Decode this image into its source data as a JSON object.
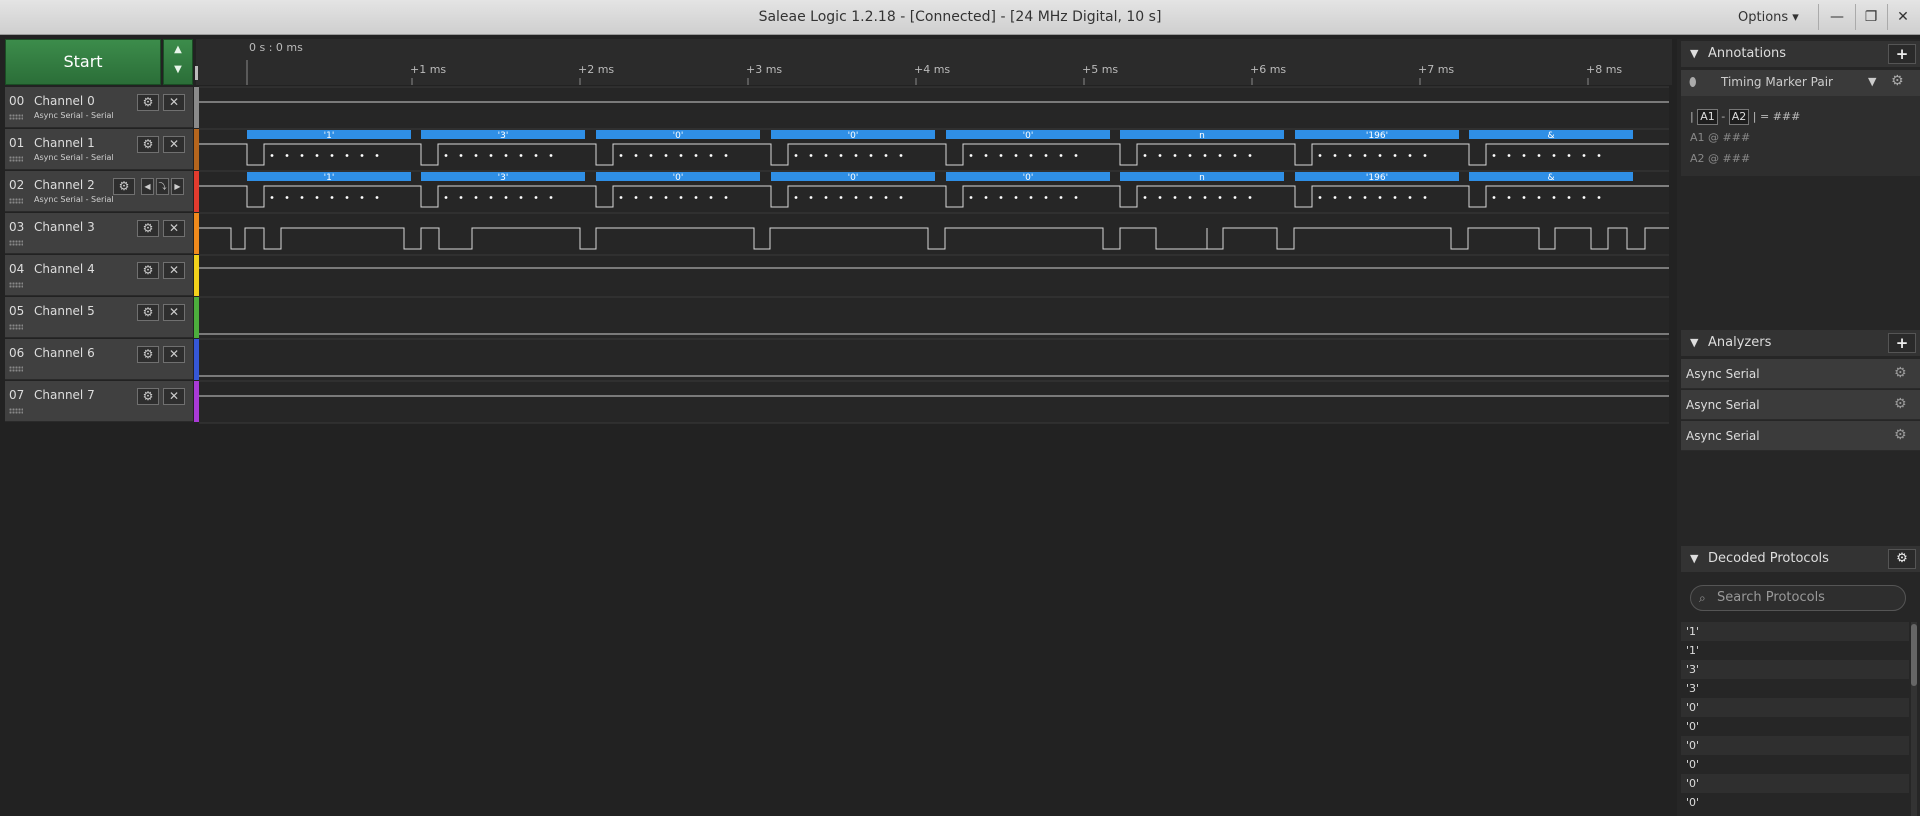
{
  "window": {
    "title": "Saleae Logic 1.2.18 - [Connected] - [24 MHz Digital, 10 s]",
    "options_label": "Options ▾",
    "minimize": "—",
    "restore": "❐",
    "close": "✕"
  },
  "capture": {
    "start_label": "Start",
    "up_arrow": "▲",
    "down_arrow": "▼"
  },
  "timeline": {
    "origin": "0 s : 0 ms",
    "ticks": [
      "+1 ms",
      "+2 ms",
      "+3 ms",
      "+4 ms",
      "+5 ms",
      "+6 ms",
      "+7 ms",
      "+8 ms"
    ]
  },
  "channels": [
    {
      "num": "00",
      "name": "Channel 0",
      "analyzer": "Async Serial - Serial",
      "color": "#8a8a8a"
    },
    {
      "num": "01",
      "name": "Channel 1",
      "analyzer": "Async Serial - Serial",
      "color": "#b5651d"
    },
    {
      "num": "02",
      "name": "Channel 2",
      "analyzer": "Async Serial - Serial",
      "color": "#e23b2e"
    },
    {
      "num": "03",
      "name": "Channel 3",
      "analyzer": "",
      "color": "#f08a1c"
    },
    {
      "num": "04",
      "name": "Channel 4",
      "analyzer": "",
      "color": "#f2d21b"
    },
    {
      "num": "05",
      "name": "Channel 5",
      "analyzer": "",
      "color": "#4cae3c"
    },
    {
      "num": "06",
      "name": "Channel 6",
      "analyzer": "",
      "color": "#3557d6"
    },
    {
      "num": "07",
      "name": "Channel 7",
      "analyzer": "",
      "color": "#a93ad6"
    }
  ],
  "channel_buttons": {
    "settings": "⚙",
    "remove": "✕",
    "prev": "◀",
    "edge": "⤵",
    "next": "▶"
  },
  "decoded_bubbles": [
    "'1'",
    "'3'",
    "'0'",
    "'0'",
    "'0'",
    "n",
    "'196'",
    "&"
  ],
  "accent_color": "#2f8fe6",
  "annotations": {
    "title": "Annotations",
    "add": "+",
    "marker_label": "Timing Marker Pair",
    "pin_icon": "⬮",
    "dropdown_icon": "▼",
    "gear_icon": "⚙",
    "a1": "A1",
    "a2": "A2",
    "dash": "-",
    "bar": "|",
    "equals": "= ###",
    "a1_line": "A1  @  ###",
    "a2_line": "A2  @  ###"
  },
  "analyzers": {
    "title": "Analyzers",
    "add": "+",
    "items": [
      "Async Serial",
      "Async Serial",
      "Async Serial"
    ],
    "gear_icon": "⚙"
  },
  "decoded_protocols": {
    "title": "Decoded Protocols",
    "gear_icon": "⚙",
    "search_placeholder": "Search Protocols",
    "search_icon": "⌕",
    "rows": [
      "'1'",
      "'1'",
      "'3'",
      "'3'",
      "'0'",
      "'0'",
      "'0'",
      "'0'",
      "'0'",
      "'0'"
    ]
  },
  "section_triangle": "▼"
}
